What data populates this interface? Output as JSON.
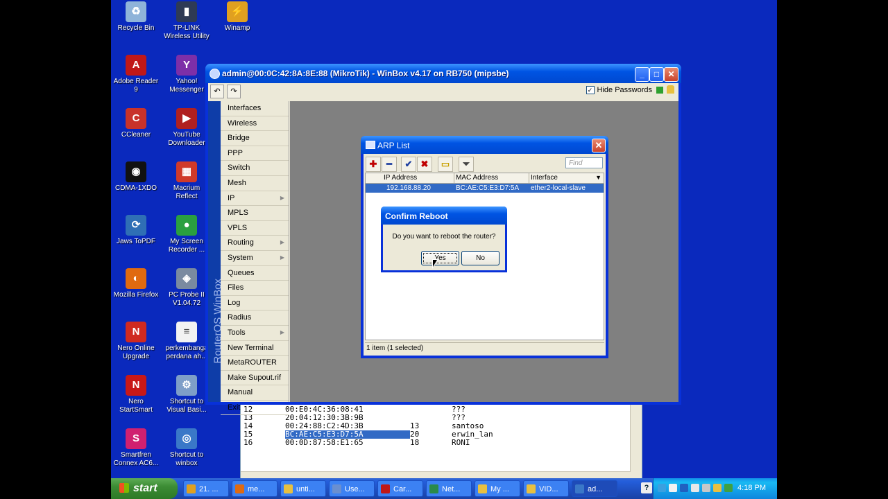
{
  "desktop_icons": [
    {
      "label": "Recycle Bin",
      "icon": "recycle-bin-icon",
      "color": "#8fb3d9",
      "glyph": "♻"
    },
    {
      "label": "TP-LINK Wireless Utility",
      "icon": "tp-link-icon",
      "color": "#2e3a55",
      "glyph": "▮"
    },
    {
      "label": "Winamp",
      "icon": "winamp-icon",
      "color": "#e0a020",
      "glyph": "⚡"
    },
    {
      "label": "Adobe Reader 9",
      "icon": "adobe-reader-icon",
      "color": "#c01818",
      "glyph": "A"
    },
    {
      "label": "Yahoo! Messenger",
      "icon": "yahoo-messenger-icon",
      "color": "#7d2fa8",
      "glyph": "Y"
    },
    {
      "label": "CCleaner",
      "icon": "ccleaner-icon",
      "color": "#c8322a",
      "glyph": "C"
    },
    {
      "label": "YouTube Downloader",
      "icon": "youtube-downloader-icon",
      "color": "#b02020",
      "glyph": "▶"
    },
    {
      "label": "CDMA-1XDO",
      "icon": "cdma-icon",
      "color": "#111111",
      "glyph": "◉"
    },
    {
      "label": "Macrium Reflect",
      "icon": "macrium-reflect-icon",
      "color": "#d03a2a",
      "glyph": "▦"
    },
    {
      "label": "Jaws ToPDF",
      "icon": "jaws-topdf-icon",
      "color": "#2f6fb5",
      "glyph": "⟳"
    },
    {
      "label": "My Screen Recorder ...",
      "icon": "screen-recorder-icon",
      "color": "#2aa040",
      "glyph": "●"
    },
    {
      "label": "Mozilla Firefox",
      "icon": "firefox-icon",
      "color": "#e06a10",
      "glyph": "◐"
    },
    {
      "label": "PC Probe II V1.04.72",
      "icon": "pc-probe-icon",
      "color": "#7a8aa0",
      "glyph": "◈"
    },
    {
      "label": "Nero Online Upgrade",
      "icon": "nero-upgrade-icon",
      "color": "#d02a20",
      "glyph": "N"
    },
    {
      "label": "perkembanga perdana ah...",
      "icon": "document-icon",
      "color": "#f2f2f2",
      "glyph": "≡"
    },
    {
      "label": "Nero StartSmart",
      "icon": "nero-startsmart-icon",
      "color": "#c81818",
      "glyph": "N"
    },
    {
      "label": "Shortcut to Visual Basi...",
      "icon": "visual-basic-icon",
      "color": "#7e9ec8",
      "glyph": "⚙"
    },
    {
      "label": "Smartfren Connex AC6...",
      "icon": "smartfren-icon",
      "color": "#d02070",
      "glyph": "S"
    },
    {
      "label": "Shortcut to winbox",
      "icon": "winbox-shortcut-icon",
      "color": "#3a78c8",
      "glyph": "◎"
    }
  ],
  "terminal_rows": [
    {
      "n": "12",
      "mac": "00:E0:4C:36:08:41",
      "id": "",
      "name": "???"
    },
    {
      "n": "13",
      "mac": "20:04:12:30:3B:9B",
      "id": "",
      "name": "???"
    },
    {
      "n": "14",
      "mac": "00:24:88:C2:4D:3B",
      "id": "13",
      "name": "santoso"
    },
    {
      "n": "15",
      "mac": "BC:AE:C5:E3:D7:5A",
      "id": "20",
      "name": "erwin_lan"
    },
    {
      "n": "16",
      "mac": "00:0D:87:58:E1:65",
      "id": "18",
      "name": "RONI"
    }
  ],
  "winbox": {
    "title": "admin@00:0C:42:8A:8E:88 (MikroTik) - WinBox v4.17 on RB750 (mipsbe)",
    "undo": "↶",
    "redo": "↷",
    "hide_passwords_label": "Hide Passwords",
    "hide_passwords_checked": "✓",
    "brand": "RouterOS WinBox",
    "menu": [
      {
        "label": "Interfaces",
        "sub": ""
      },
      {
        "label": "Wireless",
        "sub": ""
      },
      {
        "label": "Bridge",
        "sub": ""
      },
      {
        "label": "PPP",
        "sub": ""
      },
      {
        "label": "Switch",
        "sub": ""
      },
      {
        "label": "Mesh",
        "sub": ""
      },
      {
        "label": "IP",
        "sub": "▶"
      },
      {
        "label": "MPLS",
        "sub": ""
      },
      {
        "label": "VPLS",
        "sub": ""
      },
      {
        "label": "Routing",
        "sub": "▶"
      },
      {
        "label": "System",
        "sub": "▶"
      },
      {
        "label": "Queues",
        "sub": ""
      },
      {
        "label": "Files",
        "sub": ""
      },
      {
        "label": "Log",
        "sub": ""
      },
      {
        "label": "Radius",
        "sub": ""
      },
      {
        "label": "Tools",
        "sub": "▶"
      },
      {
        "label": "New Terminal",
        "sub": ""
      },
      {
        "label": "MetaROUTER",
        "sub": ""
      },
      {
        "label": "Make Supout.rif",
        "sub": ""
      },
      {
        "label": "Manual",
        "sub": ""
      },
      {
        "label": "Exit",
        "sub": ""
      }
    ]
  },
  "arp_list": {
    "title": "ARP List",
    "close": "✕",
    "find_placeholder": "Find",
    "columns": [
      "IP Address",
      "MAC Address",
      "Interface"
    ],
    "rows": [
      {
        "ip": "192.168.88.20",
        "mac": "BC:AE:C5:E3:D7:5A",
        "interface": "ether2-local-slave"
      }
    ],
    "status": "1 item (1 selected)",
    "tools": [
      {
        "name": "add-button",
        "glyph": "✚",
        "color": "#c00000"
      },
      {
        "name": "remove-button",
        "glyph": "━",
        "color": "#1e3fa0"
      },
      {
        "name": "enable-button",
        "glyph": "✔",
        "color": "#1e3fa0"
      },
      {
        "name": "disable-button",
        "glyph": "✖",
        "color": "#c00000"
      },
      {
        "name": "comment-button",
        "glyph": "▭",
        "color": "#c8a000"
      },
      {
        "name": "filter-button",
        "glyph": "⏷",
        "color": "#444444"
      }
    ]
  },
  "confirm": {
    "title": "Confirm Reboot",
    "message": "Do you want to reboot the router?",
    "yes": "Yes",
    "no": "No"
  },
  "taskbar": {
    "start": "start",
    "tasks": [
      {
        "label": "21. ...",
        "color": "#e0a020"
      },
      {
        "label": "me...",
        "color": "#e06a10"
      },
      {
        "label": "unti...",
        "color": "#e8c040"
      },
      {
        "label": "Use...",
        "color": "#6a8fd0"
      },
      {
        "label": "Car...",
        "color": "#c01818"
      },
      {
        "label": "Net...",
        "color": "#2a8a4a"
      },
      {
        "label": "My ...",
        "color": "#e8c040"
      },
      {
        "label": "VID...",
        "color": "#e8c040"
      },
      {
        "label": "ad...",
        "color": "#3a78c8"
      }
    ],
    "help": "?",
    "clock": "4:18 PM"
  }
}
